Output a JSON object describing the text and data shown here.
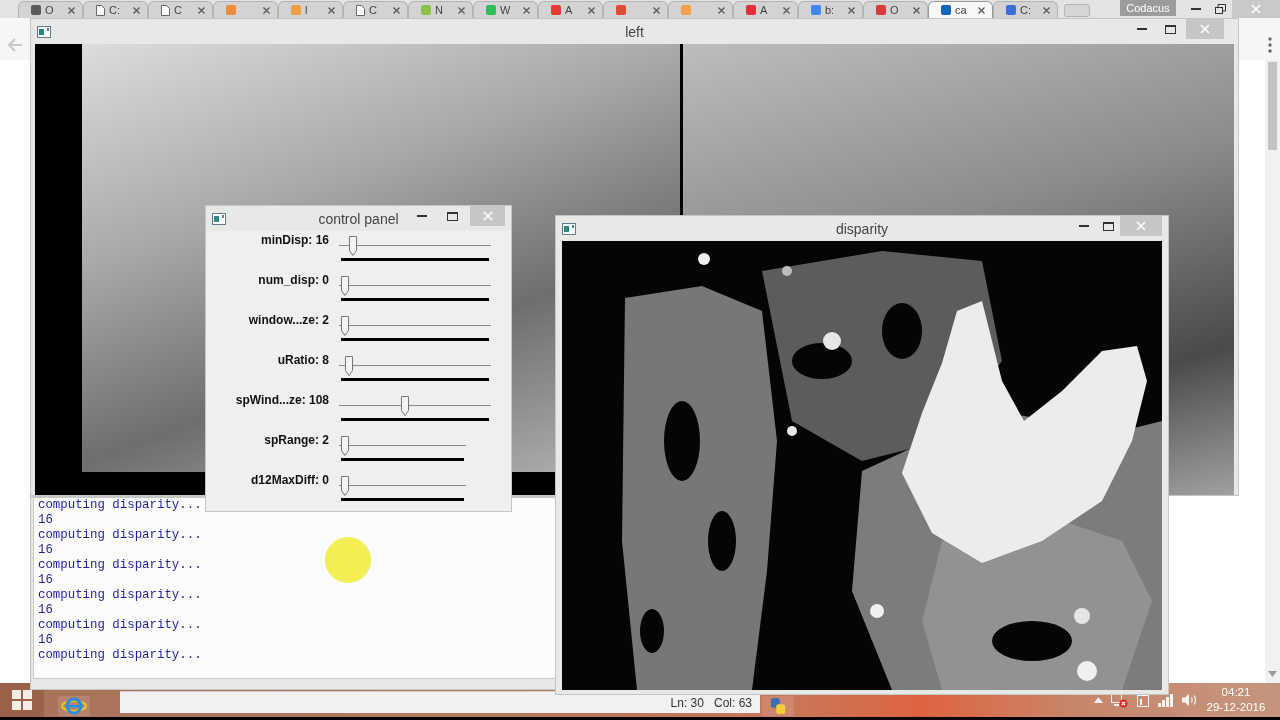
{
  "browser": {
    "tabs": [
      {
        "kind": "site",
        "color": "#5a5a5a",
        "label": "O",
        "selected": false
      },
      {
        "kind": "page",
        "label": "C:",
        "selected": false
      },
      {
        "kind": "page",
        "label": "C",
        "selected": false
      },
      {
        "kind": "site",
        "color": "#f08a3c",
        "selected": false
      },
      {
        "kind": "site",
        "color": "#f0a040",
        "label": "l",
        "selected": false
      },
      {
        "kind": "page",
        "label": "C",
        "selected": false
      },
      {
        "kind": "site",
        "color": "#8bc34a",
        "label": "N",
        "selected": false
      },
      {
        "kind": "site",
        "color": "#2fbe5a",
        "label": "W",
        "selected": false
      },
      {
        "kind": "site",
        "color": "#e53935",
        "label": "A",
        "selected": false
      },
      {
        "kind": "site",
        "color": "#e04a3a",
        "selected": false
      },
      {
        "kind": "site",
        "color": "#f3a04a",
        "selected": false
      },
      {
        "kind": "site",
        "color": "#e0303a",
        "label": "A",
        "selected": false
      },
      {
        "kind": "site",
        "color": "#4285f4",
        "label": "b:",
        "selected": false
      },
      {
        "kind": "site",
        "color": "#d93a3a",
        "label": "O",
        "selected": false
      },
      {
        "kind": "site",
        "color": "#1565c0",
        "label": "ca",
        "selected": true
      },
      {
        "kind": "site",
        "color": "#3b6fd8",
        "label": "C:",
        "selected": false
      }
    ],
    "profile": "Codacus"
  },
  "left_window": {
    "title": "left"
  },
  "control_panel": {
    "title": "control panel",
    "trackbars": [
      {
        "label": "minDisp: 16",
        "kind": "wide",
        "level": 0.06
      },
      {
        "label": "num_disp: 0",
        "kind": "wide",
        "level": 0
      },
      {
        "label": "window...ze: 2",
        "kind": "wide",
        "level": 0
      },
      {
        "label": "uRatio: 8",
        "kind": "wide",
        "level": 0.03
      },
      {
        "label": "spWind...ze: 108",
        "kind": "wide",
        "level": 0.43
      },
      {
        "label": "spRange: 2",
        "kind": "narrow",
        "level": 0
      },
      {
        "label": "d12MaxDiff: 0",
        "kind": "narrow",
        "level": 0
      }
    ]
  },
  "disparity_window": {
    "title": "disparity"
  },
  "console": {
    "lines": [
      "computing disparity...",
      "16",
      "computing disparity...",
      "16",
      "computing disparity...",
      "16",
      "computing disparity...",
      "16",
      "computing disparity...",
      "16",
      "computing disparity..."
    ]
  },
  "editor_status": {
    "line": "Ln: 30",
    "column": "Col: 63"
  },
  "taskbar": {
    "time": "04:21",
    "date": "29-12-2016"
  }
}
